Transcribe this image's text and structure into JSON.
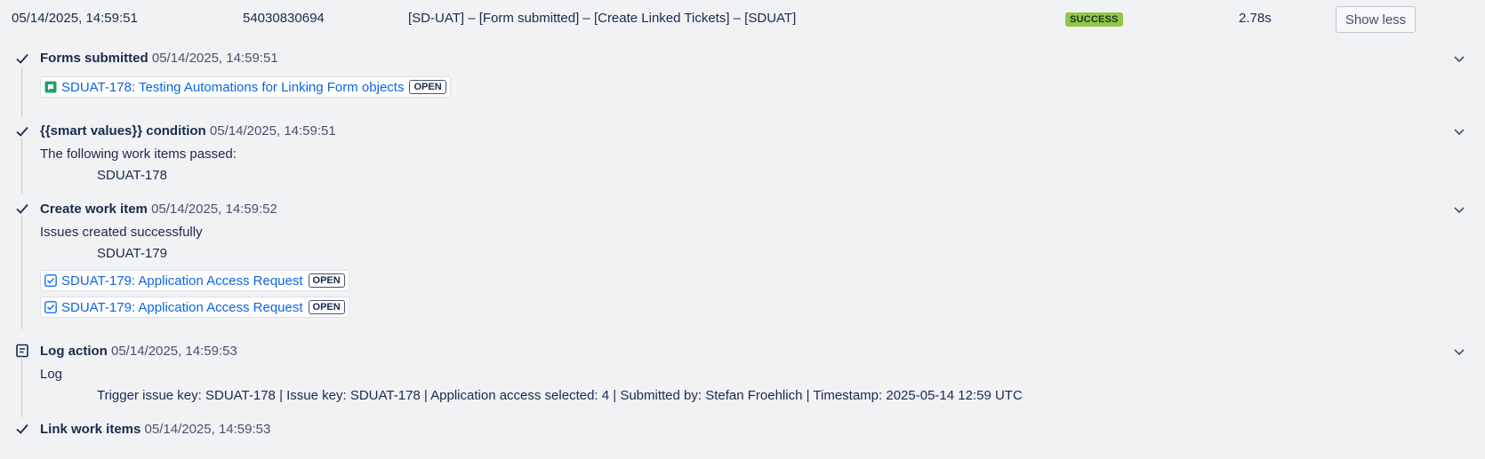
{
  "header": {
    "datetime": "05/14/2025, 14:59:51",
    "id": "54030830694",
    "rule": "[SD-UAT] – [Form submitted] – [Create Linked Tickets] – [SDUAT]",
    "status": "SUCCESS",
    "duration": "2.78s",
    "toggle_label": "Show less"
  },
  "steps": [
    {
      "icon": "check-icon",
      "title": "Forms submitted",
      "timestamp": "05/14/2025, 14:59:51",
      "cards": [
        {
          "icon": "form-icon",
          "label": "SDUAT-178: Testing Automations for Linking Form objects",
          "status": "OPEN"
        }
      ]
    },
    {
      "icon": "check-icon",
      "title": "{{smart values}} condition",
      "timestamp": "05/14/2025, 14:59:51",
      "message": "The following work items passed:",
      "detail": "SDUAT-178"
    },
    {
      "icon": "check-icon",
      "title": "Create work item",
      "timestamp": "05/14/2025, 14:59:52",
      "message": "Issues created successfully",
      "detail": "SDUAT-179",
      "cards": [
        {
          "icon": "task-icon",
          "label": "SDUAT-179:  Application Access Request",
          "status": "OPEN"
        },
        {
          "icon": "task-icon",
          "label": "SDUAT-179:  Application Access Request",
          "status": "OPEN"
        }
      ]
    },
    {
      "icon": "log-icon",
      "title": "Log action",
      "timestamp": "05/14/2025, 14:59:53",
      "message": "Log",
      "detail": "Trigger issue key: SDUAT-178 | Issue key: SDUAT-178 | Application access selected: 4 | Submitted by: Stefan Froehlich | Timestamp: 2025-05-14 12:59 UTC"
    },
    {
      "icon": "check-icon",
      "title": "Link work items",
      "timestamp": "05/14/2025, 14:59:53"
    }
  ],
  "colors": {
    "success_badge": "#94c748",
    "link": "#0c66e4",
    "form_icon": "#22a06b",
    "task_icon": "#1d7afc"
  }
}
